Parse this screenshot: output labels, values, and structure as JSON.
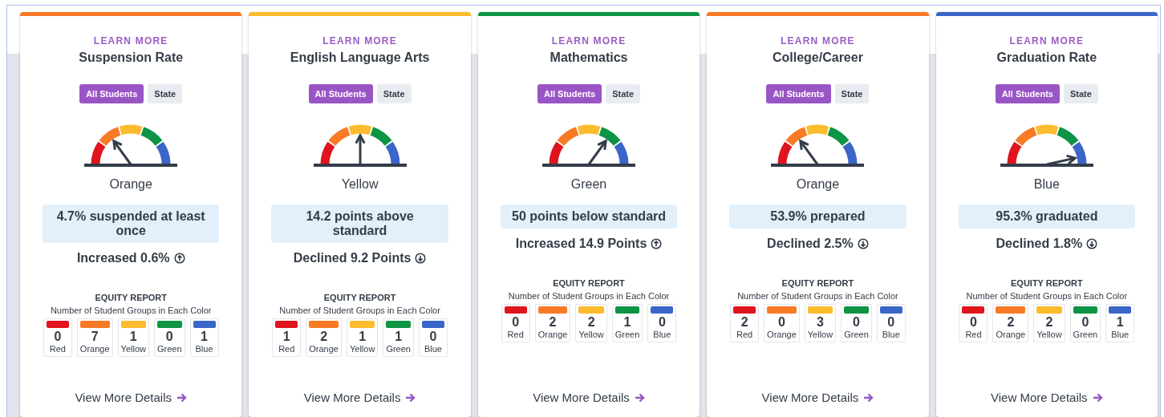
{
  "cards": [
    {
      "link": "LEARN MORE",
      "title": "Suspension Rate",
      "color": "#f97a25",
      "toggles": [
        {
          "label": "All Students",
          "selected": true
        },
        {
          "label": "State",
          "selected": false
        }
      ],
      "status": "Orange",
      "statement": "4.7% suspended at least once",
      "change": "Increased 0.6%",
      "kind": "up",
      "equity_title": "EQUITY REPORT",
      "equity_subtitle": "Number of Student Groups in Each Color",
      "groups": [
        {
          "count": "0",
          "label": "Red",
          "color": "#e0141e"
        },
        {
          "count": "7",
          "label": "Orange",
          "color": "#f97a25"
        },
        {
          "count": "1",
          "label": "Yellow",
          "color": "#fdbb2e"
        },
        {
          "count": "0",
          "label": "Green",
          "color": "#0d9444"
        },
        {
          "count": "1",
          "label": "Blue",
          "color": "#3a66c9"
        }
      ],
      "details": "View More Details"
    },
    {
      "link": "LEARN MORE",
      "title": "English Language Arts",
      "color": "#fdbb2e",
      "toggles": [
        {
          "label": "All Students",
          "selected": true
        },
        {
          "label": "State",
          "selected": false
        }
      ],
      "status": "Yellow",
      "statement": "14.2 points above standard",
      "change": "Declined 9.2 Points",
      "kind": "down",
      "equity_title": "EQUITY REPORT",
      "equity_subtitle": "Number of Student Groups in Each Color",
      "groups": [
        {
          "count": "1",
          "label": "Red",
          "color": "#e0141e"
        },
        {
          "count": "2",
          "label": "Orange",
          "color": "#f97a25"
        },
        {
          "count": "1",
          "label": "Yellow",
          "color": "#fdbb2e"
        },
        {
          "count": "1",
          "label": "Green",
          "color": "#0d9444"
        },
        {
          "count": "0",
          "label": "Blue",
          "color": "#3a66c9"
        }
      ],
      "details": "View More Details"
    },
    {
      "link": "LEARN MORE",
      "title": "Mathematics",
      "color": "#0d9444",
      "toggles": [
        {
          "label": "All Students",
          "selected": true
        },
        {
          "label": "State",
          "selected": false
        }
      ],
      "status": "Green",
      "statement": "50 points below standard",
      "change": "Increased 14.9 Points",
      "kind": "up",
      "equity_title": "EQUITY REPORT",
      "equity_subtitle": "Number of Student Groups in Each Color",
      "groups": [
        {
          "count": "0",
          "label": "Red",
          "color": "#e0141e"
        },
        {
          "count": "2",
          "label": "Orange",
          "color": "#f97a25"
        },
        {
          "count": "2",
          "label": "Yellow",
          "color": "#fdbb2e"
        },
        {
          "count": "1",
          "label": "Green",
          "color": "#0d9444"
        },
        {
          "count": "0",
          "label": "Blue",
          "color": "#3a66c9"
        }
      ],
      "details": "View More Details"
    },
    {
      "link": "LEARN MORE",
      "title": "College/Career",
      "color": "#f97a25",
      "toggles": [
        {
          "label": "All Students",
          "selected": true
        },
        {
          "label": "State",
          "selected": false
        }
      ],
      "status": "Orange",
      "statement": "53.9% prepared",
      "change": "Declined 2.5%",
      "kind": "down",
      "equity_title": "EQUITY REPORT",
      "equity_subtitle": "Number of Student Groups in Each Color",
      "groups": [
        {
          "count": "2",
          "label": "Red",
          "color": "#e0141e"
        },
        {
          "count": "0",
          "label": "Orange",
          "color": "#f97a25"
        },
        {
          "count": "3",
          "label": "Yellow",
          "color": "#fdbb2e"
        },
        {
          "count": "0",
          "label": "Green",
          "color": "#0d9444"
        },
        {
          "count": "0",
          "label": "Blue",
          "color": "#3a66c9"
        }
      ],
      "details": "View More Details"
    },
    {
      "link": "LEARN MORE",
      "title": "Graduation Rate",
      "color": "#3a66c9",
      "toggles": [
        {
          "label": "All Students",
          "selected": true
        },
        {
          "label": "State",
          "selected": false
        }
      ],
      "status": "Blue",
      "statement": "95.3% graduated",
      "change": "Declined 1.8%",
      "kind": "down",
      "equity_title": "EQUITY REPORT",
      "equity_subtitle": "Number of Student Groups in Each Color",
      "groups": [
        {
          "count": "0",
          "label": "Red",
          "color": "#e0141e"
        },
        {
          "count": "2",
          "label": "Orange",
          "color": "#f97a25"
        },
        {
          "count": "2",
          "label": "Yellow",
          "color": "#fdbb2e"
        },
        {
          "count": "0",
          "label": "Green",
          "color": "#0d9444"
        },
        {
          "count": "1",
          "label": "Blue",
          "color": "#3a66c9"
        }
      ],
      "details": "View More Details"
    }
  ]
}
